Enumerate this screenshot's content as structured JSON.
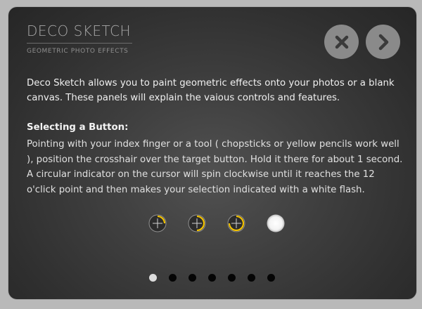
{
  "brand": {
    "title": "DECO SKETCH",
    "subtitle": "GEOMETRIC PHOTO EFFECTS"
  },
  "nav": {
    "close_icon": "close-icon",
    "next_icon": "chevron-right-icon",
    "button_color": "#8a8a8a",
    "icon_color": "#3a3a3a"
  },
  "content": {
    "intro": "Deco Sketch allows you to paint geometric effects onto your photos or a blank canvas. These panels will explain the vaious controls and features.",
    "section_title": "Selecting a Button:",
    "body": "Pointing with your index finger or a tool ( chopsticks or yellow pencils work well ), position the crosshair over the target button. Hold it there for about 1 second. A circular indicator on the cursor will spin clockwise until it reaches the 12 o'click point and then makes your selection indicated with a white flash."
  },
  "indicator_sequence": [
    {
      "icon": "crosshair-progress-icon",
      "progress": 0.25
    },
    {
      "icon": "crosshair-progress-icon",
      "progress": 0.5
    },
    {
      "icon": "crosshair-progress-icon",
      "progress": 0.75
    },
    {
      "icon": "white-flash-icon",
      "progress": 1.0
    }
  ],
  "accent_color": "#f2c200",
  "pagination": {
    "count": 7,
    "active_index": 0
  }
}
